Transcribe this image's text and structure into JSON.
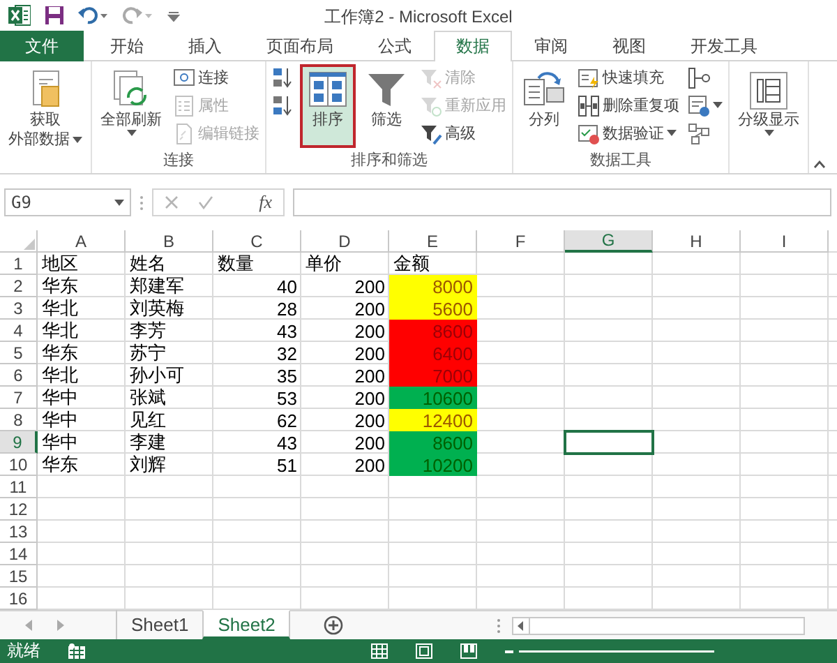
{
  "window": {
    "title": "工作簿2 - Microsoft Excel"
  },
  "ribbon_tabs": [
    {
      "label": "文件",
      "kind": "file",
      "selected": false
    },
    {
      "label": "开始",
      "kind": "tab",
      "selected": false
    },
    {
      "label": "插入",
      "kind": "tab",
      "selected": false
    },
    {
      "label": "页面布局",
      "kind": "tab",
      "selected": false
    },
    {
      "label": "公式",
      "kind": "tab",
      "selected": false
    },
    {
      "label": "数据",
      "kind": "tab",
      "selected": true
    },
    {
      "label": "审阅",
      "kind": "tab",
      "selected": false
    },
    {
      "label": "视图",
      "kind": "tab",
      "selected": false
    },
    {
      "label": "开发工具",
      "kind": "tab",
      "selected": false
    }
  ],
  "ribbon_groups": [
    {
      "items": [
        {
          "kind": "large",
          "label": [
            "获取",
            "外部数据"
          ],
          "disabled": false,
          "highlighted": false,
          "dropdown": true
        }
      ]
    },
    {
      "label": "连接",
      "items": [
        {
          "kind": "large",
          "label": "全部刷新",
          "disabled": false,
          "highlighted": false,
          "dropdown": true
        },
        {
          "kind": "small",
          "label": "连接",
          "disabled": false
        },
        {
          "kind": "small",
          "label": "属性",
          "disabled": true
        },
        {
          "kind": "small",
          "label": "编辑链接",
          "disabled": true
        }
      ]
    },
    {
      "label": "排序和筛选",
      "items": [
        {
          "kind": "icon",
          "disabled": false
        },
        {
          "kind": "icon",
          "disabled": false
        },
        {
          "kind": "large",
          "label": "排序",
          "disabled": false,
          "highlighted": true
        },
        {
          "kind": "large",
          "label": "筛选",
          "disabled": false,
          "highlighted": false
        },
        {
          "kind": "small",
          "label": "清除",
          "disabled": true
        },
        {
          "kind": "small",
          "label": "重新应用",
          "disabled": true
        },
        {
          "kind": "small",
          "label": "高级",
          "disabled": false
        }
      ]
    },
    {
      "label": "数据工具",
      "items": [
        {
          "kind": "large",
          "label": "分列",
          "disabled": false,
          "highlighted": false
        },
        {
          "kind": "small",
          "label": "快速填充",
          "disabled": false
        },
        {
          "kind": "small",
          "label": "删除重复项",
          "disabled": false
        },
        {
          "kind": "small",
          "label": "数据验证",
          "disabled": false,
          "dropdown": true
        },
        {
          "kind": "icon",
          "disabled": false
        },
        {
          "kind": "icon",
          "disabled": false,
          "dropdown": true
        },
        {
          "kind": "icon",
          "disabled": false
        }
      ]
    },
    {
      "items": [
        {
          "kind": "large",
          "label": "分级显示",
          "disabled": false,
          "highlighted": false,
          "dropdown": true
        }
      ]
    }
  ],
  "formula_bar": {
    "name_box": "G9",
    "function_label": "fx"
  },
  "grid": {
    "columns": [
      {
        "label": "A",
        "selected": false
      },
      {
        "label": "B",
        "selected": false
      },
      {
        "label": "C",
        "selected": false
      },
      {
        "label": "D",
        "selected": false
      },
      {
        "label": "E",
        "selected": false
      },
      {
        "label": "F",
        "selected": false
      },
      {
        "label": "G",
        "selected": true
      },
      {
        "label": "H",
        "selected": false
      },
      {
        "label": "I",
        "selected": false
      }
    ],
    "rows": [
      {
        "label": "1",
        "selected": false,
        "cells": [
          {
            "text": "地区",
            "kind": "text"
          },
          {
            "text": "姓名",
            "kind": "text"
          },
          {
            "text": "数量",
            "kind": "text"
          },
          {
            "text": "单价",
            "kind": "text"
          },
          {
            "text": "金额",
            "kind": "text"
          }
        ]
      },
      {
        "label": "2",
        "selected": false,
        "cells": [
          {
            "text": "华东",
            "kind": "text"
          },
          {
            "text": "郑建军",
            "kind": "text"
          },
          {
            "text": "40",
            "kind": "number"
          },
          {
            "text": "200",
            "kind": "number"
          },
          {
            "text": "8000",
            "kind": "number",
            "color": "#ffff00"
          }
        ]
      },
      {
        "label": "3",
        "selected": false,
        "cells": [
          {
            "text": "华北",
            "kind": "text"
          },
          {
            "text": "刘英梅",
            "kind": "text"
          },
          {
            "text": "28",
            "kind": "number"
          },
          {
            "text": "200",
            "kind": "number"
          },
          {
            "text": "5600",
            "kind": "number",
            "color": "#ffff00"
          }
        ]
      },
      {
        "label": "4",
        "selected": false,
        "cells": [
          {
            "text": "华北",
            "kind": "text"
          },
          {
            "text": "李芳",
            "kind": "text"
          },
          {
            "text": "43",
            "kind": "number"
          },
          {
            "text": "200",
            "kind": "number"
          },
          {
            "text": "8600",
            "kind": "number",
            "color": "#ff0000"
          }
        ]
      },
      {
        "label": "5",
        "selected": false,
        "cells": [
          {
            "text": "华东",
            "kind": "text"
          },
          {
            "text": "苏宁",
            "kind": "text"
          },
          {
            "text": "32",
            "kind": "number"
          },
          {
            "text": "200",
            "kind": "number"
          },
          {
            "text": "6400",
            "kind": "number",
            "color": "#ff0000"
          }
        ]
      },
      {
        "label": "6",
        "selected": false,
        "cells": [
          {
            "text": "华北",
            "kind": "text"
          },
          {
            "text": "孙小可",
            "kind": "text"
          },
          {
            "text": "35",
            "kind": "number"
          },
          {
            "text": "200",
            "kind": "number"
          },
          {
            "text": "7000",
            "kind": "number",
            "color": "#ff0000"
          }
        ]
      },
      {
        "label": "7",
        "selected": false,
        "cells": [
          {
            "text": "华中",
            "kind": "text"
          },
          {
            "text": "张斌",
            "kind": "text"
          },
          {
            "text": "53",
            "kind": "number"
          },
          {
            "text": "200",
            "kind": "number"
          },
          {
            "text": "10600",
            "kind": "number",
            "color": "#00b050"
          }
        ]
      },
      {
        "label": "8",
        "selected": false,
        "cells": [
          {
            "text": "华中",
            "kind": "text"
          },
          {
            "text": "见红",
            "kind": "text"
          },
          {
            "text": "62",
            "kind": "number"
          },
          {
            "text": "200",
            "kind": "number"
          },
          {
            "text": "12400",
            "kind": "number",
            "color": "#ffff00"
          }
        ]
      },
      {
        "label": "9",
        "selected": true,
        "cells": [
          {
            "text": "华中",
            "kind": "text"
          },
          {
            "text": "李建",
            "kind": "text"
          },
          {
            "text": "43",
            "kind": "number"
          },
          {
            "text": "200",
            "kind": "number"
          },
          {
            "text": "8600",
            "kind": "number",
            "color": "#00b050"
          }
        ]
      },
      {
        "label": "10",
        "selected": false,
        "cells": [
          {
            "text": "华东",
            "kind": "text"
          },
          {
            "text": "刘辉",
            "kind": "text"
          },
          {
            "text": "51",
            "kind": "number"
          },
          {
            "text": "200",
            "kind": "number"
          },
          {
            "text": "10200",
            "kind": "number",
            "color": "#00b050"
          }
        ]
      },
      {
        "label": "11",
        "selected": false
      },
      {
        "label": "12",
        "selected": false
      },
      {
        "label": "13",
        "selected": false
      },
      {
        "label": "14",
        "selected": false
      },
      {
        "label": "15",
        "selected": false
      },
      {
        "label": "16",
        "selected": false
      }
    ]
  },
  "sheet_tabs": [
    {
      "label": "Sheet1",
      "selected": false
    },
    {
      "label": "Sheet2",
      "selected": true
    }
  ],
  "status_bar": {
    "text": "就绪"
  }
}
